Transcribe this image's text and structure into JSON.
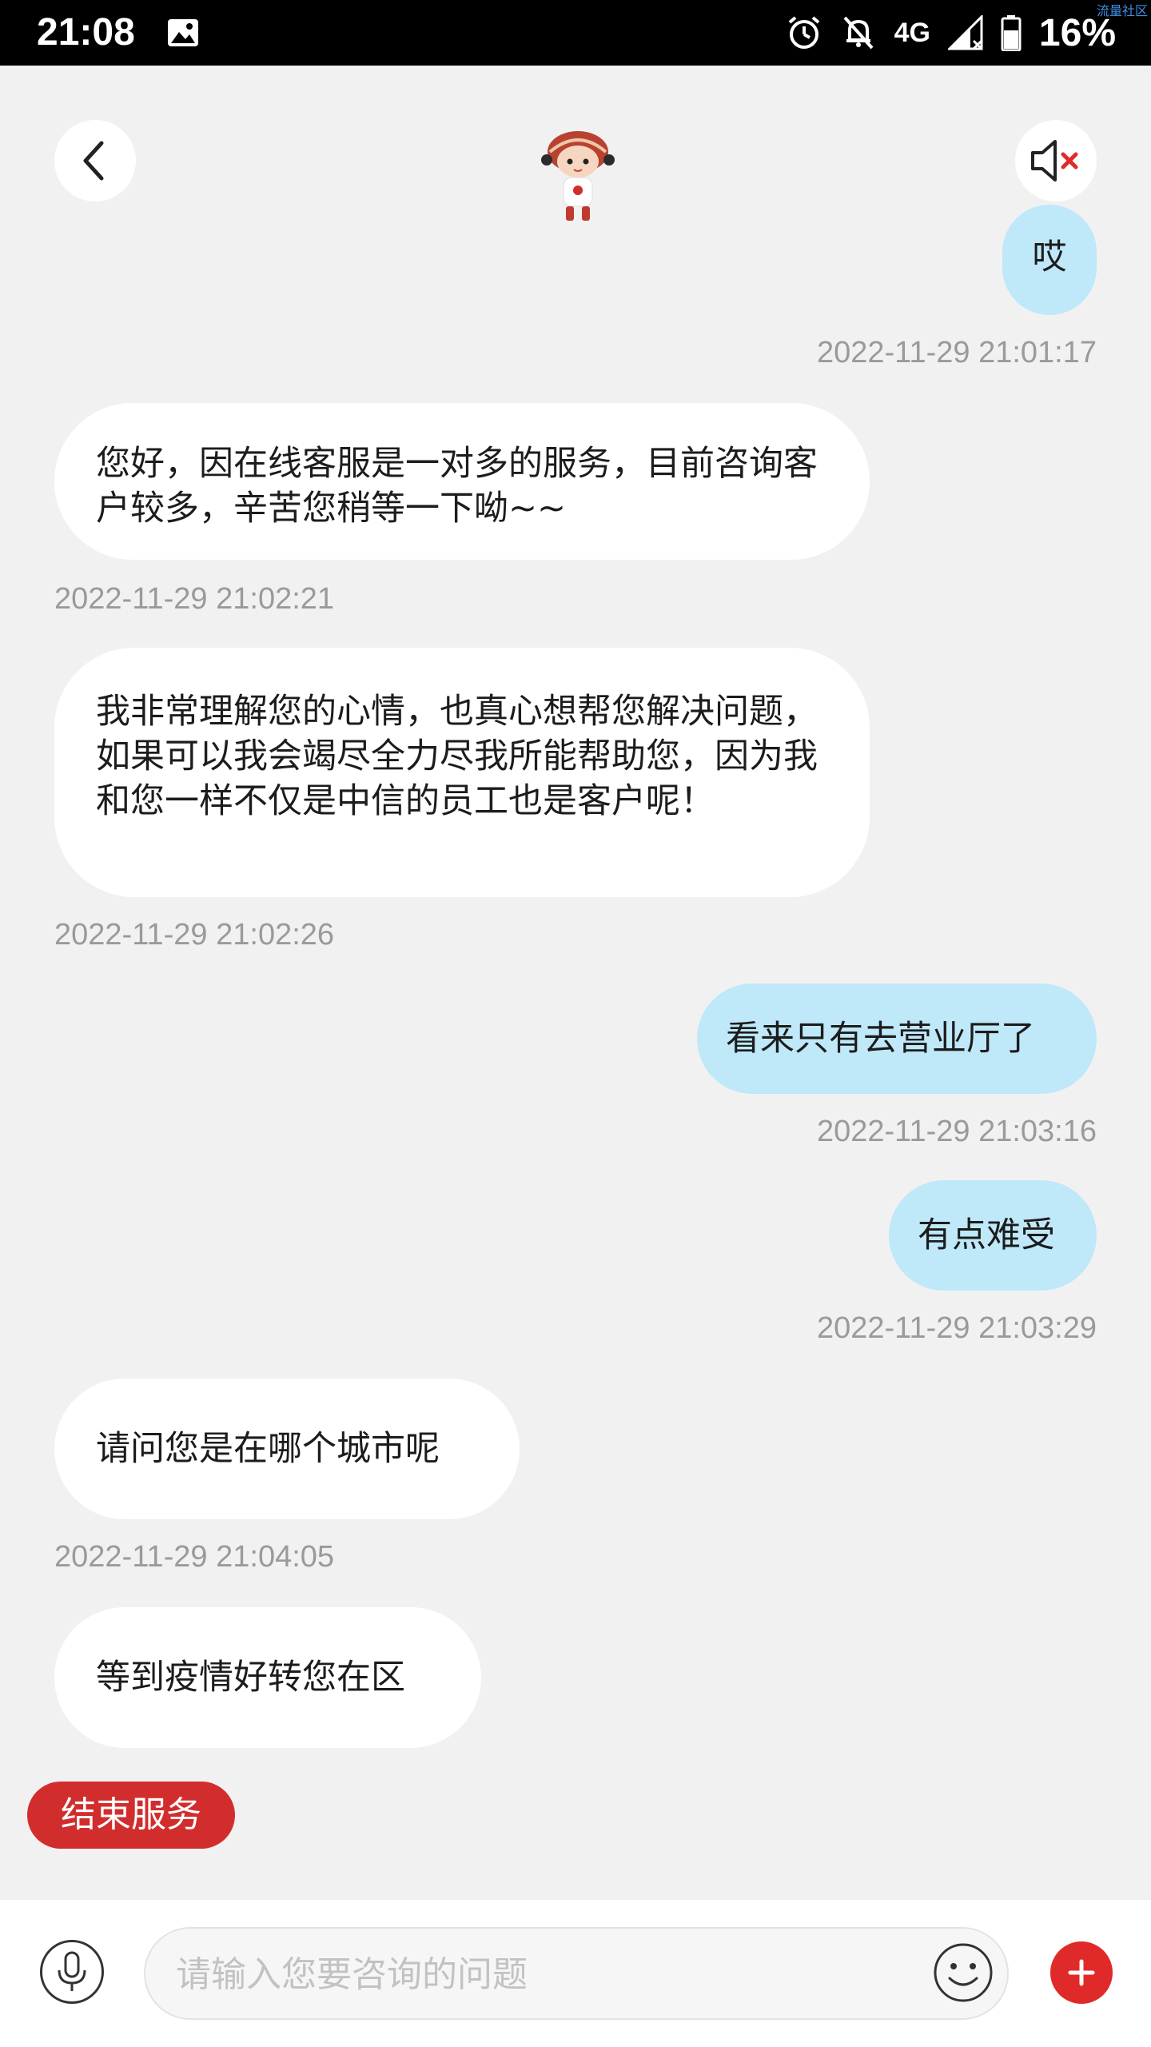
{
  "status_bar": {
    "time": "21:08",
    "network": "4G",
    "battery": "16%",
    "watermark": "流量社区"
  },
  "header": {
    "back_icon": "chevron-left-icon",
    "mute_icon": "speaker-muted-icon",
    "mascot": "mascot-avatar"
  },
  "messages": [
    {
      "side": "right",
      "text": "哎",
      "timestamp": "2022-11-29 21:01:17"
    },
    {
      "side": "left",
      "text": "您好，因在线客服是一对多的服务，目前咨询客户较多，辛苦您稍等一下呦~~",
      "timestamp": "2022-11-29 21:02:21"
    },
    {
      "side": "left",
      "text": "我非常理解您的心情，也真心想帮您解决问题，如果可以我会竭尽全力尽我所能帮助您，因为我和您一样不仅是中信的员工也是客户呢！",
      "timestamp": "2022-11-29 21:02:26"
    },
    {
      "side": "right",
      "text": "看来只有去营业厅了",
      "timestamp": "2022-11-29 21:03:16"
    },
    {
      "side": "right",
      "text": "有点难受",
      "timestamp": "2022-11-29 21:03:29"
    },
    {
      "side": "left",
      "text": "请问您是在哪个城市呢",
      "timestamp": "2022-11-29 21:04:05"
    },
    {
      "side": "left",
      "text": "等到疫情好转您在区",
      "timestamp": ""
    }
  ],
  "end_service_label": "结束服务",
  "input": {
    "placeholder": "请输入您要咨询的问题",
    "value": ""
  },
  "colors": {
    "accent_red": "#d22d2d",
    "user_bubble": "#bfe8f9",
    "agent_bubble": "#ffffff",
    "background": "#f2f1f2"
  }
}
